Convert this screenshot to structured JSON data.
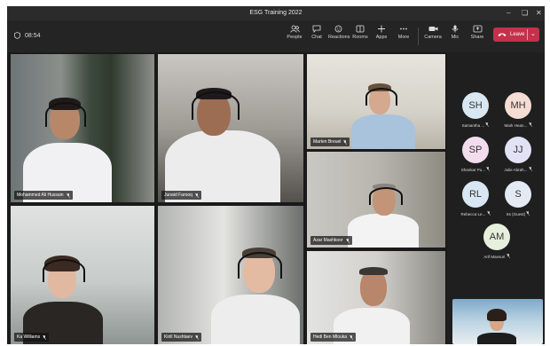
{
  "window": {
    "title": "ESG Training 2022"
  },
  "meeting": {
    "elapsed": "08:54"
  },
  "toolbar": {
    "people": "People",
    "chat": "Chat",
    "reactions": "Reactions",
    "rooms": "Rooms",
    "apps": "Apps",
    "more": "More",
    "camera": "Camera",
    "mic": "Mic",
    "share": "Share",
    "leave": "Leave"
  },
  "video_tiles": [
    {
      "name": "Mohammed Ali Hussain"
    },
    {
      "name": "Junaid Farooq"
    },
    {
      "name": "Marten Breuel"
    },
    {
      "name": "Azar Mashkoor"
    },
    {
      "name": "Ka Williams"
    },
    {
      "name": "Kirill Nushtaev"
    },
    {
      "name": "Hedi Ben Mlouka"
    }
  ],
  "roster": [
    {
      "initials": "SH",
      "name": "Samantha ...",
      "color": "#d9e7f2"
    },
    {
      "initials": "MH",
      "name": "Mark Hean...",
      "color": "#f5ddd3"
    },
    {
      "initials": "SP",
      "name": "Shankar Pu...",
      "color": "#f4dcef"
    },
    {
      "initials": "JJ",
      "name": "Julie Abrah...",
      "color": "#e3e1f4"
    },
    {
      "initials": "RL",
      "name": "Rebecca Le...",
      "color": "#d9e7f4"
    },
    {
      "initials": "S",
      "name": "Ss (Guest)",
      "color": "#e3eaf4"
    },
    {
      "initials": "AM",
      "name": "Arif Mansuri",
      "color": "#e6f0dc"
    }
  ],
  "colors": {
    "leave": "#c4314b",
    "app_bg": "#1f1f1f",
    "toolbar_bg": "#242424"
  }
}
